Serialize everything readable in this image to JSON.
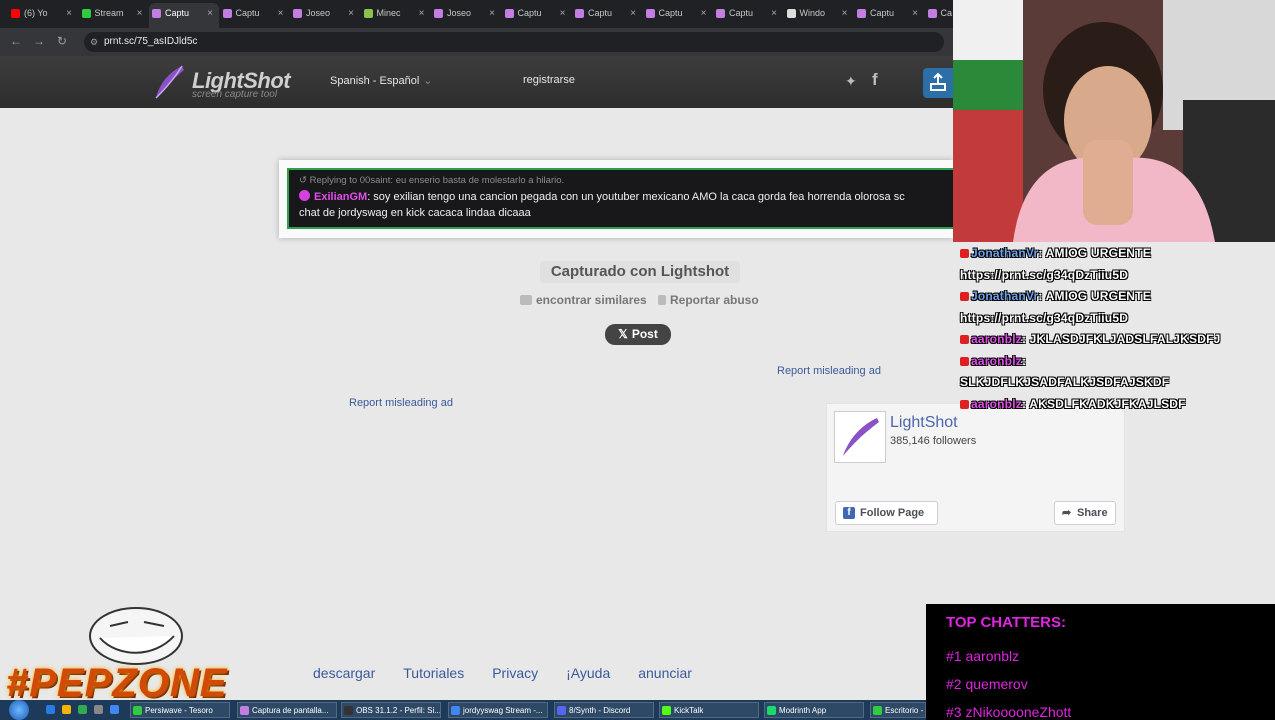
{
  "browser": {
    "tabs": [
      {
        "label": "(6) Yo",
        "color": "#ff0000"
      },
      {
        "label": "Stream",
        "color": "#2ecc40"
      },
      {
        "label": "Captu",
        "color": "#c27ee0",
        "active": true
      },
      {
        "label": "Captu",
        "color": "#c27ee0"
      },
      {
        "label": "Joseo",
        "color": "#c27ee0"
      },
      {
        "label": "Minec",
        "color": "#8bc34a"
      },
      {
        "label": "Joseo",
        "color": "#c27ee0"
      },
      {
        "label": "Captu",
        "color": "#c27ee0"
      },
      {
        "label": "Captu",
        "color": "#c27ee0"
      },
      {
        "label": "Captu",
        "color": "#c27ee0"
      },
      {
        "label": "Captu",
        "color": "#c27ee0"
      },
      {
        "label": "Windo",
        "color": "#dddddd"
      },
      {
        "label": "Captu",
        "color": "#c27ee0"
      },
      {
        "label": "Ca",
        "color": "#c27ee0"
      }
    ],
    "url": "prnt.sc/75_asIDJld5c"
  },
  "header": {
    "logo": "LightShot",
    "tagline": "screen capture tool",
    "language": "Spanish - Español",
    "register": "registrarse"
  },
  "screenshot": {
    "reply": "Replying to 00saint: eu enserio basta de molestarlo a hilario.",
    "username": "ExilianGM",
    "message_line1": ": soy exilian tengo una cancion pegada con un youtuber mexicano AMO la caca gorda fea horrenda olorosa sc",
    "message_line2": "chat de jordyswag en kick cacaca lindaa dicaaa"
  },
  "page": {
    "captured": "Capturado con Lightshot",
    "find_similar": "encontrar similares",
    "report_abuse": "Reportar abuso",
    "post": "Post",
    "report_ad_1": "Report misleading ad",
    "report_ad_2": "Report misleading ad"
  },
  "facebook": {
    "name": "LightShot",
    "followers": "385,146 followers",
    "follow": "Follow Page",
    "share": "Share"
  },
  "footer": {
    "links": [
      "descargar",
      "Tutoriales",
      "Privacy",
      "¡Ayuda",
      "anunciar"
    ]
  },
  "stream_chat": [
    {
      "user": "JonathanVr",
      "text": ": AMIOG URGENTE",
      "user_color": "u1"
    },
    {
      "user": "",
      "text": "https://prnt.sc/g34qDzTiiu5D",
      "user_color": ""
    },
    {
      "user": "JonathanVr",
      "text": ": AMIOG URGENTE",
      "user_color": "u1"
    },
    {
      "user": "",
      "text": "https://prnt.sc/g34qDzTiiu5D",
      "user_color": ""
    },
    {
      "user": "aaronblz",
      "text": ": JKLASDJFKLJADSLFALJKSDFJ",
      "user_color": "u2"
    },
    {
      "user": "aaronblz",
      "text": ":",
      "user_color": "u2"
    },
    {
      "user": "",
      "text": "SLKJDFLKJSADFALKJSDFAJSKDF",
      "user_color": ""
    },
    {
      "user": "aaronblz",
      "text": ": AKSDLFKADKJFKAJLSDF",
      "user_color": "u2"
    }
  ],
  "top_chatters": {
    "title": "TOP CHATTERS:",
    "rows": [
      "#1 aaronblz",
      "#2 quemerov",
      "#3 zNikooooneZhott"
    ]
  },
  "overlay": {
    "pepzone": "#PEPZONE"
  },
  "taskbar": [
    {
      "label": "Persiwave - Tesoro",
      "color": "#2ecc40"
    },
    {
      "label": "Captura de pantalla...",
      "color": "#c27ee0"
    },
    {
      "label": "OBS 31.1.2 - Perfil: Si...",
      "color": "#333333"
    },
    {
      "label": "jordyyswag Stream -...",
      "color": "#4285f4"
    },
    {
      "label": "8/Synth - Discord",
      "color": "#5865f2"
    },
    {
      "label": "KickTalk",
      "color": "#53fc18"
    },
    {
      "label": "Modrinth App",
      "color": "#1bd96a"
    },
    {
      "label": "Escritorio -",
      "color": "#2ecc40"
    }
  ],
  "colors": {
    "header_bg": "#2d2d2d",
    "page_bg": "#e8e8e8",
    "link": "#3a5a9a",
    "chatter_pink": "#e024e0",
    "fb_blue": "#4267b2"
  }
}
